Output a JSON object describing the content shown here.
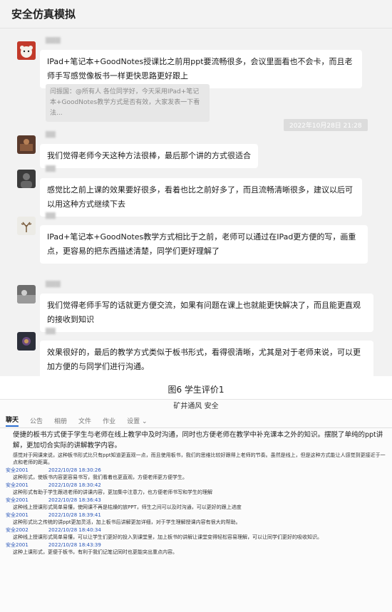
{
  "chat": {
    "title": "安全仿真模拟",
    "messages": [
      {
        "text": "IPad+笔记本+GoodNotes授课比之前用ppt要流畅很多，会议里面看也不会卡，而且老师手写感觉像板书一样更快思路更好跟上",
        "quote": "闫振国：@所有人 各位同学好，今天采用IPad+笔记本+GoodNotes教学方式是否有效，大家发表一下看法..."
      },
      {
        "text": "我们觉得老师今天这种方法很棒，最后那个讲的方式很适合"
      },
      {
        "text": "感觉比之前上课的效果要好很多，看着也比之前好多了，而且流畅清晰很多，建议以后可以用这种方式继续下去"
      },
      {
        "text": "IPad+笔记本+GoodNotes教学方式相比于之前，老师可以通过在IPad更方便的写，画重点，更容易的把东西描述清楚，同学们更好理解了"
      },
      {
        "text": "我们觉得老师手写的话就更方便交流，如果有问题在课上也就能更快解决了，而且能更直观的接收到知识"
      },
      {
        "text": "效果很好的，最后的教学方式类似于板书形式，看得很清晰，尤其是对于老师来说，可以更加方便的与同学们进行沟通。"
      }
    ],
    "timestamp": "2022年10月28日 21:28"
  },
  "caption": "图6  学生评价1",
  "panel": {
    "title": "矿井通风 安全",
    "tabs": [
      "聊天",
      "公告",
      "相册",
      "文件",
      "作业",
      "设置"
    ],
    "first_text": "便捷的板书方式便于学生与老师在线上教学中及时沟通，同时也方便老师在教学中补充课本之外的知识。摆脱了单纯的ppt讲解，更加切合实际的讲解教学内容。",
    "entries": [
      {
        "sender": "",
        "time": "",
        "text": "感觉对于网课来说，这种板书形式比只有ppt知道更直观一点，而且使用板书，我们的思维比较好跟得上老师的节奏。虽然是线上，但是这种方式能让人感觉到更接近于一点和老师的距离。"
      },
      {
        "sender": "安全2001",
        "time": "2022/10/28 18:30:26",
        "text": "这种形式，使板书内容更容易书写，我们看着也更直观，方便老师更方便学生。"
      },
      {
        "sender": "安全2001",
        "time": "2022/10/28 18:30:42",
        "text": "这种形式有助于学生跟进老师的讲课内容，更加集中注意力，也方便老师书写和学生的理解"
      },
      {
        "sender": "安全2001",
        "time": "2022/10/28 18:36:43",
        "text": "这种线上授课形式简单易懂，使网课不再是枯燥的放PPT，师生之间可以及时沟通，可以更好的跟上进度"
      },
      {
        "sender": "安全2001",
        "time": "2022/10/28 18:39:41",
        "text": "这种形式比之传统的讲ppt更加灵活，加上板书后讲解更加详细，对于学生理解授课内容有很大的帮助。"
      },
      {
        "sender": "安全2002",
        "time": "2022/10/28 18:40:34",
        "text": "这种线上授课形式简单易懂，可以让学生们更好的投入到课堂里，加上板书的讲解让课堂变得轻松容易理解，可以让同学们更好的吸收知识。"
      },
      {
        "sender": "安全2001",
        "time": "2022/10/28 18:43:39",
        "text": "这种上课形式，更便于板书，有利于我们记笔记同时也更能突出重点内容。"
      }
    ]
  }
}
